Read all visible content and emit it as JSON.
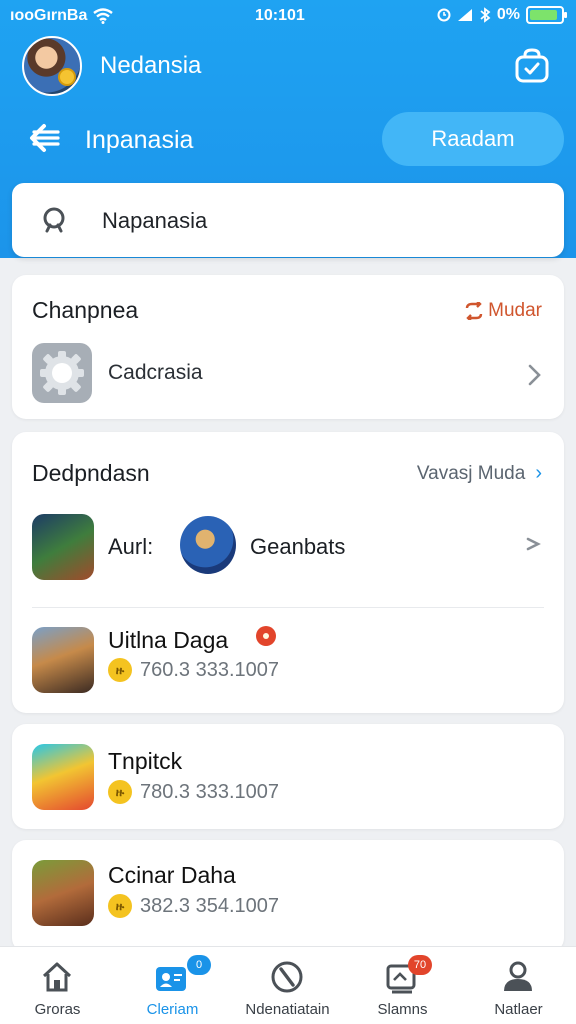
{
  "status_bar": {
    "carrier": "ıooGırnBa",
    "time": "10:101",
    "battery": "0%",
    "battery_level": 0.9
  },
  "profile": {
    "name": "Nedansia"
  },
  "title_bar": {
    "title": "Inpanasia",
    "action_label": "Raadam"
  },
  "search": {
    "value": "Napanasia"
  },
  "section_1": {
    "title": "Chanpnea",
    "link": "Mudar",
    "item_label": "Cadcrasia"
  },
  "section_2": {
    "title": "Dedpndasn",
    "link": "Vavasj Muda",
    "pair": {
      "label_a": "Aurl:",
      "label_b": "Geanbats"
    },
    "items": [
      {
        "name": "Uitlna Daga",
        "score": "760.3 333.1007"
      }
    ]
  },
  "cards": [
    {
      "name": "Tnpitck",
      "score": "780.3 333.1007"
    },
    {
      "name": "Ccinar Daha",
      "score": "382.3 354.1007"
    }
  ],
  "nav": {
    "items": [
      {
        "label": "Groras",
        "icon": "home-icon"
      },
      {
        "label": "Cleriam",
        "icon": "contacts-icon",
        "badge": "0"
      },
      {
        "label": "Ndenatiatain",
        "icon": "compass-icon"
      },
      {
        "label": "Slamns",
        "icon": "inbox-icon",
        "badge": "70"
      },
      {
        "label": "Natlaer",
        "icon": "person-icon"
      }
    ]
  },
  "colors": {
    "brand_blue": "#1c94ea",
    "accent_orange": "#d0562e",
    "coin_gold": "#f4c320",
    "badge_red": "#e2452b"
  }
}
